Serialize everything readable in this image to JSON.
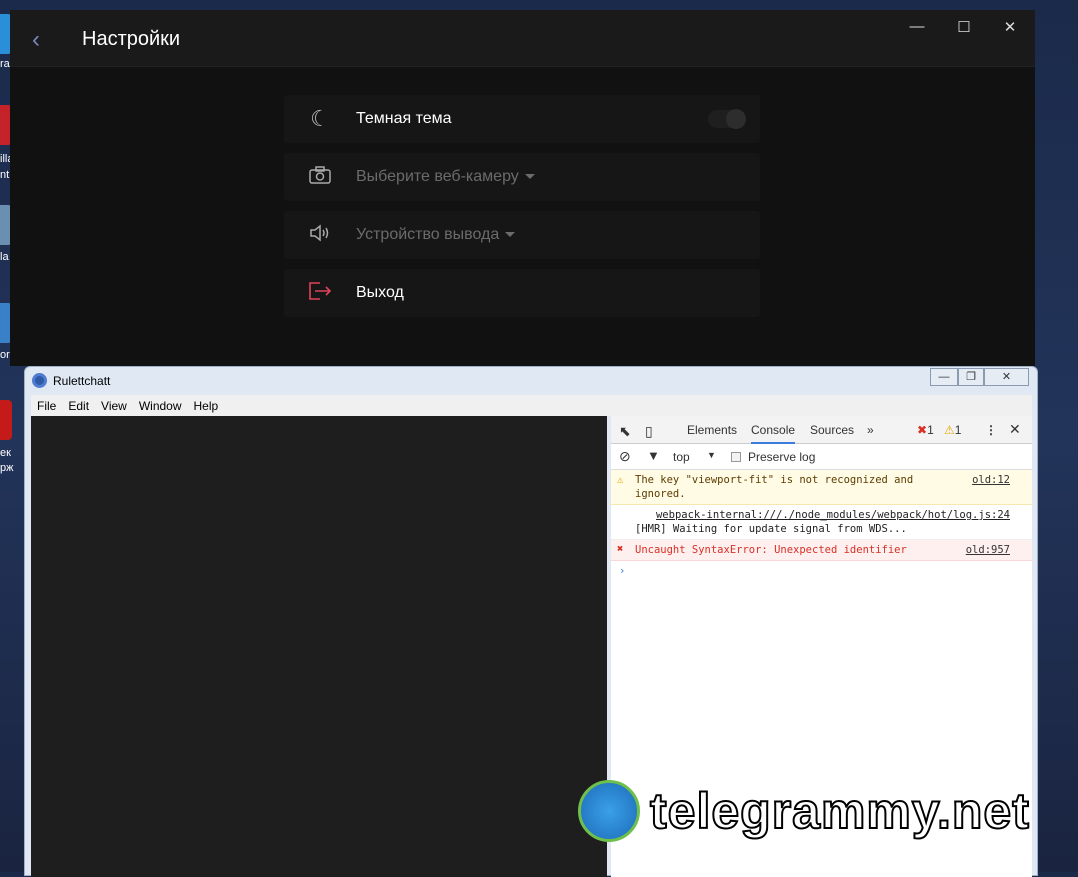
{
  "settings": {
    "title": "Настройки",
    "items": [
      {
        "label": "Темная тема"
      },
      {
        "label": "Выберите веб-камеру"
      },
      {
        "label": "Устройство вывода"
      },
      {
        "label": "Выход"
      }
    ],
    "dark_theme_on": false
  },
  "app": {
    "title": "Rulettchatt",
    "menu": [
      "File",
      "Edit",
      "View",
      "Window",
      "Help"
    ]
  },
  "devtools": {
    "tabs": [
      "Elements",
      "Console",
      "Sources"
    ],
    "active_tab": "Console",
    "more": "»",
    "errors": "1",
    "warnings": "1",
    "context": "top",
    "preserve_log": "Preserve log",
    "messages": [
      {
        "type": "warning",
        "text": "The key \"viewport-fit\" is not recognized and ignored.",
        "source": "old:12"
      },
      {
        "type": "log",
        "source": "webpack-internal:///./node_modules/webpack/hot/log.js:24",
        "text": "[HMR] Waiting for update signal from WDS..."
      },
      {
        "type": "error",
        "text": "Uncaught SyntaxError: Unexpected identifier",
        "source": "old:957"
      }
    ],
    "prompt": "›"
  },
  "desktop": {
    "labels": [
      "ra",
      "illa",
      "nt",
      "la",
      "or",
      "ек",
      "рж"
    ]
  },
  "watermark": "telegrammy.net",
  "colors": {
    "exit": "#e0435a",
    "error": "#d93025",
    "warning_bg": "#fffbe5",
    "error_bg": "#fff0f0"
  }
}
